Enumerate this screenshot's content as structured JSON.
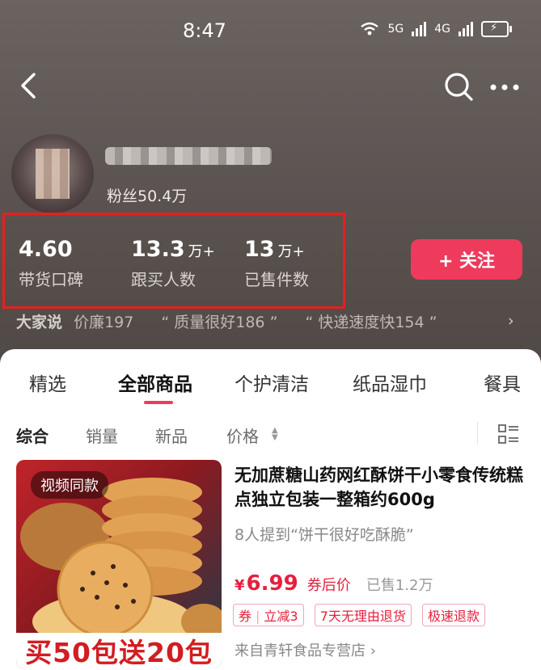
{
  "status_bar": {
    "time": "8:47",
    "network_1": "5G",
    "network_2": "4G",
    "icons": [
      "wifi-icon",
      "signal-icon",
      "signal-icon",
      "battery-charging-icon"
    ]
  },
  "nav": {
    "icons": [
      "back-arrow-icon",
      "search-icon",
      "more-icon"
    ]
  },
  "profile": {
    "fans": "粉丝50.4万",
    "follow_label": "+ 关注"
  },
  "stats": [
    {
      "value": "4.60",
      "unit": "",
      "label": "带货口碑"
    },
    {
      "value": "13.3",
      "unit": "万+",
      "label": "跟买人数"
    },
    {
      "value": "13",
      "unit": "万+",
      "label": "已售件数"
    }
  ],
  "reviews": {
    "lead": "大家说",
    "chips": [
      "价廉197",
      "“ 质量很好186 ”",
      "“ 快递速度快154 ”"
    ]
  },
  "tabs": [
    "精选",
    "全部商品",
    "个护清洁",
    "纸品湿巾",
    "餐具"
  ],
  "active_tab": "全部商品",
  "filters": [
    "综合",
    "销量",
    "新品",
    "价格"
  ],
  "product": {
    "video_tag": "视频同款",
    "promo": "买50包送20包",
    "title": "无加蔗糖山药网红酥饼干小零食传统糕点独立包装一整箱约600g",
    "mention": "8人提到“饼干很好吃酥脆”",
    "price_symbol": "¥",
    "price": "6.99",
    "price_note": "券后价",
    "sold": "已售1.2万",
    "coupon_tag_1": "券",
    "coupon_tag_2": "立减3",
    "tag_2": "7天无理由退货",
    "tag_3": "极速退款",
    "shop": "来自青轩食品专营店"
  },
  "colors": {
    "accent": "#ee3b5b",
    "price": "#e5203c",
    "highlight_box": "#e5201f"
  }
}
